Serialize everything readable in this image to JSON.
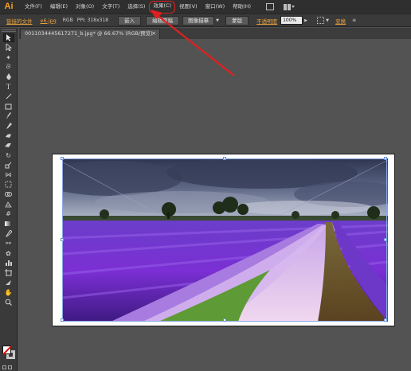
{
  "app": {
    "logo_text": "Ai"
  },
  "menu": {
    "items": [
      "文件(F)",
      "编辑(E)",
      "对象(O)",
      "文字(T)",
      "选择(S)",
      "效果(C)",
      "视图(V)",
      "窗口(W)",
      "帮助(H)"
    ],
    "highlighted_item": "效果(C)"
  },
  "controlbar": {
    "linked_file_label": "链接的文件",
    "filename": "e6.jpg",
    "colorspace": "RGB",
    "ppi": "PPI: 318x318",
    "embed_button": "嵌入",
    "edit_original_button": "编辑原稿",
    "image_trace_button": "图像描摹",
    "mask_button": "蒙版",
    "opacity_label": "不透明度",
    "opacity_value": "100%",
    "transform_label": "变换"
  },
  "document": {
    "tab_title": "0011034445617271_b.jpg* @ 66.67% (RGB/预览)",
    "close_glyph": "×"
  },
  "toolbar": {
    "tools": [
      "selection-tool",
      "direct-selection-tool",
      "magic-wand-tool",
      "lasso-tool",
      "pen-tool",
      "type-tool",
      "line-tool",
      "rectangle-tool",
      "paintbrush-tool",
      "pencil-tool",
      "blob-brush-tool",
      "eraser-tool",
      "rotate-tool",
      "scale-tool",
      "width-tool",
      "free-transform-tool",
      "shape-builder-tool",
      "perspective-grid-tool",
      "mesh-tool",
      "gradient-tool",
      "eyedropper-tool",
      "blend-tool",
      "symbol-sprayer-tool",
      "column-graph-tool",
      "artboard-tool",
      "slice-tool",
      "hand-tool",
      "zoom-tool"
    ],
    "selected_tool": "selection-tool"
  },
  "colors": {
    "accent": "#e8a23a",
    "annotation": "#e02020",
    "selection": "#6a8fdc"
  }
}
